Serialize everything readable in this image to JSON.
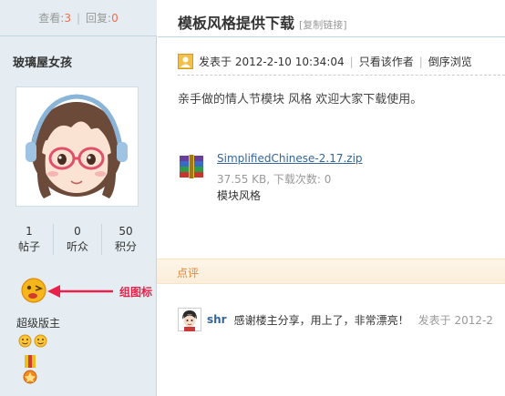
{
  "stats_bar": {
    "views_label": "查看:",
    "views": "3",
    "replies_label": "回复:",
    "replies": "0"
  },
  "author": {
    "name": "玻璃屋女孩",
    "stats": [
      {
        "value": "1",
        "label": "帖子"
      },
      {
        "value": "0",
        "label": "听众"
      },
      {
        "value": "50",
        "label": "积分"
      }
    ],
    "rank": "超级版主",
    "annotation": "组图标"
  },
  "thread": {
    "title": "模板风格提供下载",
    "copy_link": "[复制链接]",
    "posted_at": "发表于 2012-2-10 10:34:04",
    "author_only": "只看该作者",
    "reverse_order": "倒序浏览",
    "content": "亲手做的情人节模块 风格 欢迎大家下载使用。",
    "attachment": {
      "filename": "SimplifiedChinese-2.17.zip",
      "size_info": "37.55 KB, 下载次数: 0",
      "description": "模块风格"
    }
  },
  "comments": {
    "section_label": "点评",
    "items": [
      {
        "user": "shr",
        "text": "感谢楼主分享，用上了，非常漂亮！",
        "time": "发表于 2012-2"
      }
    ]
  },
  "colors": {
    "accent": "#f26c4f",
    "link": "#336699",
    "annotation": "#e8204a",
    "comment_label": "#e5863a"
  }
}
